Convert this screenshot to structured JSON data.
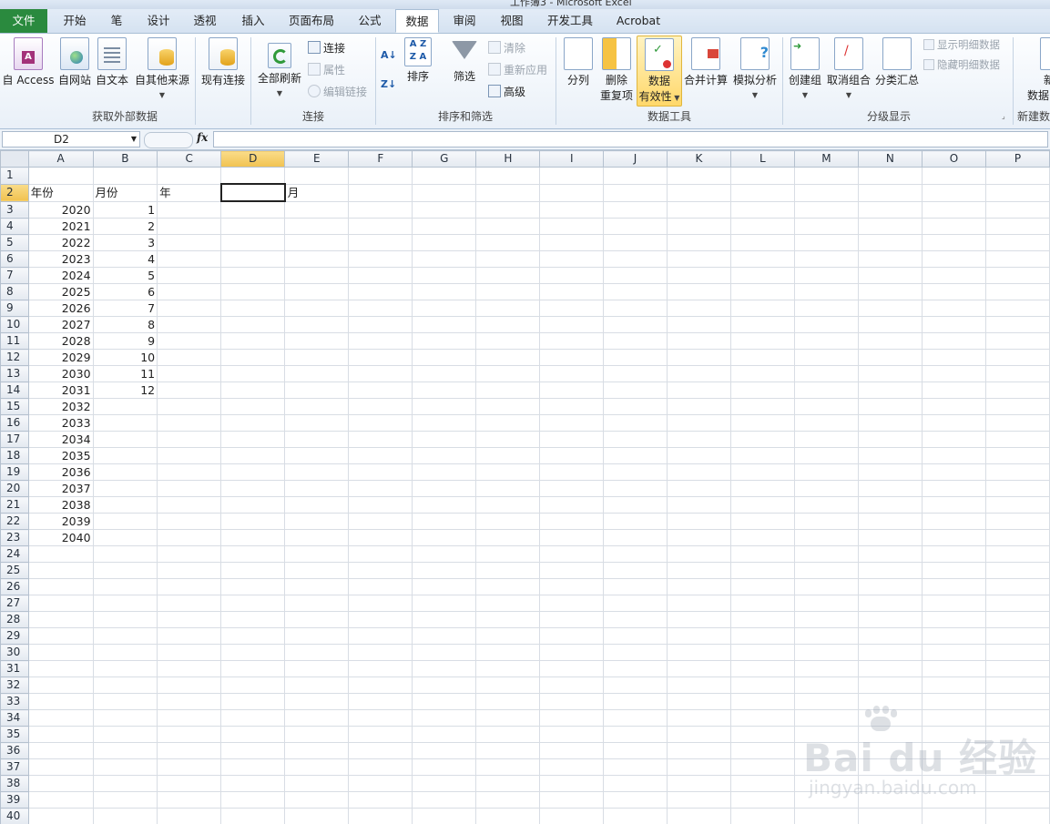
{
  "window": {
    "title": "工作簿3 - Microsoft Excel"
  },
  "tabs": [
    "文件",
    "开始",
    "笔",
    "设计",
    "透视",
    "插入",
    "页面布局",
    "公式",
    "数据",
    "审阅",
    "视图",
    "开发工具",
    "Acrobat"
  ],
  "active_tab": "数据",
  "ribbon": {
    "get_external": {
      "label": "获取外部数据",
      "access": "自 Access",
      "web": "自网站",
      "text": "自文本",
      "other": "自其他来源",
      "existing": "现有连接"
    },
    "connections": {
      "label": "连接",
      "refresh_all": "全部刷新",
      "connections": "连接",
      "properties": "属性",
      "edit_links": "编辑链接"
    },
    "sort_filter": {
      "label": "排序和筛选",
      "sort": "排序",
      "filter": "筛选",
      "clear": "清除",
      "reapply": "重新应用",
      "advanced": "高级"
    },
    "data_tools": {
      "label": "数据工具",
      "text_to_columns": "分列",
      "remove_dup_1": "删除",
      "remove_dup_2": "重复项",
      "validation_1": "数据",
      "validation_2": "有效性",
      "consolidate": "合并计算",
      "what_if": "模拟分析"
    },
    "outline": {
      "label": "分级显示",
      "group": "创建组",
      "ungroup": "取消组合",
      "subtotal": "分类汇总",
      "show_detail": "显示明细数据",
      "hide_detail": "隐藏明细数据"
    },
    "new_group": {
      "label": "新建数",
      "btn_1": "新",
      "btn_2": "数据"
    }
  },
  "formula_bar": {
    "name_box": "D2",
    "fx": "fx",
    "value": ""
  },
  "columns": [
    "A",
    "B",
    "C",
    "D",
    "E",
    "F",
    "G",
    "H",
    "I",
    "J",
    "K",
    "L",
    "M",
    "N",
    "O",
    "P"
  ],
  "selected_column": "D",
  "selected_row": 2,
  "rows": [
    {
      "n": "1",
      "a": "",
      "b": "",
      "c": "",
      "d": "",
      "e": ""
    },
    {
      "n": "2",
      "a": "年份",
      "b": "月份",
      "c": "年",
      "d": "",
      "e": "月"
    },
    {
      "n": "3",
      "a": "2020",
      "b": "1"
    },
    {
      "n": "4",
      "a": "2021",
      "b": "2"
    },
    {
      "n": "5",
      "a": "2022",
      "b": "3"
    },
    {
      "n": "6",
      "a": "2023",
      "b": "4"
    },
    {
      "n": "7",
      "a": "2024",
      "b": "5"
    },
    {
      "n": "8",
      "a": "2025",
      "b": "6"
    },
    {
      "n": "9",
      "a": "2026",
      "b": "7"
    },
    {
      "n": "10",
      "a": "2027",
      "b": "8"
    },
    {
      "n": "11",
      "a": "2028",
      "b": "9"
    },
    {
      "n": "12",
      "a": "2029",
      "b": "10"
    },
    {
      "n": "13",
      "a": "2030",
      "b": "11"
    },
    {
      "n": "14",
      "a": "2031",
      "b": "12"
    },
    {
      "n": "15",
      "a": "2032"
    },
    {
      "n": "16",
      "a": "2033"
    },
    {
      "n": "17",
      "a": "2034"
    },
    {
      "n": "18",
      "a": "2035"
    },
    {
      "n": "19",
      "a": "2036"
    },
    {
      "n": "20",
      "a": "2037"
    },
    {
      "n": "21",
      "a": "2038"
    },
    {
      "n": "22",
      "a": "2039"
    },
    {
      "n": "23",
      "a": "2040"
    },
    {
      "n": "24"
    },
    {
      "n": "25"
    },
    {
      "n": "26"
    },
    {
      "n": "27"
    },
    {
      "n": "28"
    },
    {
      "n": "29"
    },
    {
      "n": "30"
    },
    {
      "n": "31"
    },
    {
      "n": "32"
    },
    {
      "n": "33"
    },
    {
      "n": "34"
    },
    {
      "n": "35"
    },
    {
      "n": "36"
    },
    {
      "n": "37"
    },
    {
      "n": "38"
    },
    {
      "n": "39"
    },
    {
      "n": "40"
    }
  ],
  "watermark": {
    "brand": "Bai du 经验",
    "url": "jingyan.baidu.com"
  },
  "colors": {
    "file_tab": "#2a8a3e",
    "selection_header": "#f1c250",
    "ribbon_highlight": "#ffd86a"
  }
}
